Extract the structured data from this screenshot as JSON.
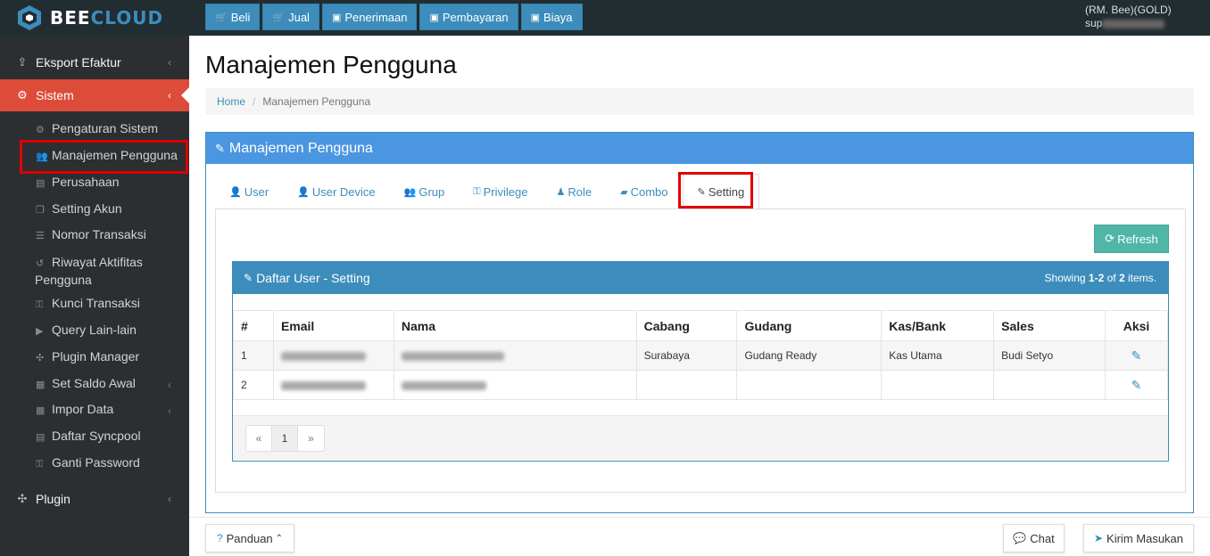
{
  "brand": {
    "part1": "BEE",
    "part2": "CLOUD"
  },
  "nav": {
    "items": [
      {
        "icon": "cart-icon",
        "label": "Beli"
      },
      {
        "icon": "cart-icon",
        "label": "Jual"
      },
      {
        "icon": "money-icon",
        "label": "Penerimaan"
      },
      {
        "icon": "money-icon",
        "label": "Pembayaran"
      },
      {
        "icon": "money-icon",
        "label": "Biaya"
      }
    ]
  },
  "user": {
    "company": "(RM. Bee)(GOLD)",
    "name_prefix": "sup"
  },
  "sidebar": {
    "eksport": "Eksport Efaktur",
    "sistem": "Sistem",
    "sub": [
      "Pengaturan Sistem",
      "Manajemen Pengguna",
      "Perusahaan",
      "Setting Akun",
      "Nomor Transaksi",
      "Riwayat Aktifitas",
      "Pengguna",
      "Kunci Transaksi",
      "Query Lain-lain",
      "Plugin Manager",
      "Set Saldo Awal",
      "Impor Data",
      "Daftar Syncpool",
      "Ganti Password"
    ],
    "plugin": "Plugin"
  },
  "page": {
    "title": "Manajemen Pengguna"
  },
  "breadcrumb": {
    "home": "Home",
    "current": "Manajemen Pengguna"
  },
  "panel": {
    "title": "Manajemen Pengguna"
  },
  "tabs": [
    "User",
    "User Device",
    "Grup",
    "Privilege",
    "Role",
    "Combo",
    "Setting"
  ],
  "refresh_label": "Refresh",
  "list": {
    "title": "Daftar User - Setting",
    "showing_prefix": "Showing",
    "showing_range": "1-2",
    "showing_of": "of",
    "showing_total": "2",
    "showing_suffix": "items."
  },
  "table": {
    "headers": [
      "#",
      "Email",
      "Nama",
      "Cabang",
      "Gudang",
      "Kas/Bank",
      "Sales",
      "Aksi"
    ],
    "rows": [
      {
        "no": "1",
        "cabang": "Surabaya",
        "gudang": "Gudang Ready",
        "kas": "Kas Utama",
        "sales": "Budi Setyo"
      },
      {
        "no": "2",
        "cabang": "",
        "gudang": "",
        "kas": "",
        "sales": ""
      }
    ]
  },
  "pager": {
    "prev": "«",
    "page": "1",
    "next": "»"
  },
  "bottom": {
    "panduan": "Panduan",
    "chat": "Chat",
    "kirim": "Kirim Masukan"
  },
  "colors": {
    "primary": "#3c8dbc",
    "panel_head": "#4b96e0",
    "active": "#dd4b39",
    "refresh": "#4fb6a8",
    "sidebar": "#2c2f31",
    "highlight": "#e00000"
  }
}
